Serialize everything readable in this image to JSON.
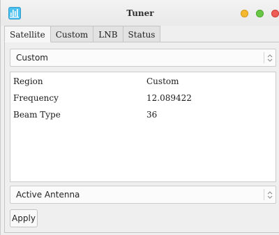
{
  "window": {
    "title": "Tuner",
    "app_icon": "tuner-app-icon"
  },
  "tabs": [
    {
      "label": "Satellite",
      "active": true
    },
    {
      "label": "Custom",
      "active": false
    },
    {
      "label": "LNB",
      "active": false
    },
    {
      "label": "Status",
      "active": false
    }
  ],
  "satellite": {
    "selected": "Custom",
    "details": [
      {
        "key": "Region",
        "value": "Custom"
      },
      {
        "key": "Frequency",
        "value": "12.089422"
      },
      {
        "key": "Beam Type",
        "value": "36"
      }
    ],
    "antenna_selected": "Active Antenna",
    "apply_label": "Apply"
  },
  "colors": {
    "close": "#ed5d56",
    "minimize": "#f5b930",
    "maximize": "#69c746",
    "app_icon": "#4cc0ef"
  }
}
